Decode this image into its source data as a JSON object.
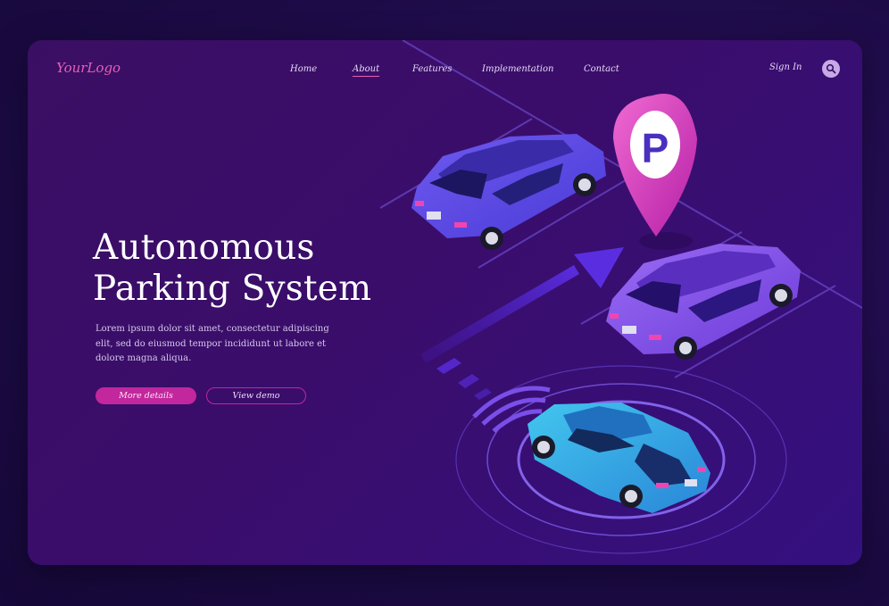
{
  "brand": {
    "logo_text": "YourLogo"
  },
  "nav": {
    "items": [
      {
        "label": "Home",
        "active": false
      },
      {
        "label": "About",
        "active": true
      },
      {
        "label": "Features",
        "active": false
      },
      {
        "label": "Implementation",
        "active": false
      },
      {
        "label": "Contact",
        "active": false
      }
    ],
    "sign_in": "Sign In",
    "search_icon": "search-icon"
  },
  "hero": {
    "title_line1": "Autonomous",
    "title_line2": "Parking System",
    "description": "Lorem ipsum dolor sit amet, consectetur adipiscing elit, sed do eiusmod tempor incididunt ut labore et dolore magna aliqua.",
    "primary_button": "More details",
    "secondary_button": "View demo"
  },
  "illustration": {
    "parking_pin_letter": "P"
  },
  "colors": {
    "accent": "#c2279d",
    "logo": "#e85fb8",
    "background": "#1d0b47"
  }
}
